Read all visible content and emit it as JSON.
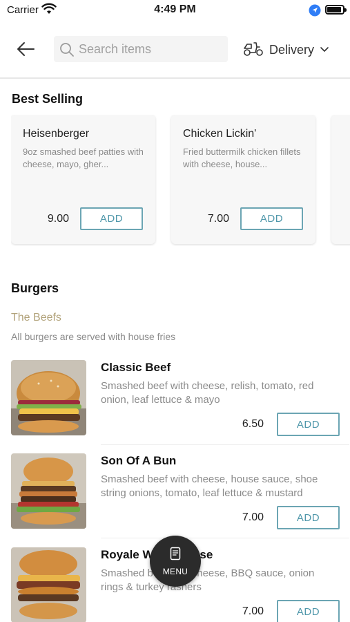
{
  "status_bar": {
    "carrier": "Carrier",
    "time": "4:49 PM"
  },
  "header": {
    "search_placeholder": "Search items",
    "delivery_label": "Delivery"
  },
  "best_selling": {
    "title": "Best Selling",
    "items": [
      {
        "name": "Heisenberger",
        "description": "9oz smashed beef patties with cheese, mayo, gher...",
        "price": "9.00",
        "add_label": "ADD"
      },
      {
        "name": "Chicken Lickin'",
        "description": "Fried buttermilk chicken fillets with cheese, house...",
        "price": "7.00",
        "add_label": "ADD"
      }
    ]
  },
  "burgers": {
    "title": "Burgers",
    "category": "The Beefs",
    "note": "All burgers are served with house fries",
    "items": [
      {
        "name": "Classic Beef",
        "description": "Smashed beef with cheese, relish, tomato, red onion, leaf lettuce & mayo",
        "price": "6.50",
        "add_label": "ADD"
      },
      {
        "name": "Son Of A Bun",
        "description": "Smashed beef with cheese, house sauce, shoe string onions, tomato, leaf lettuce & mustard",
        "price": "7.00",
        "add_label": "ADD"
      },
      {
        "name": "Royale With Cheese",
        "description": "Smashed beef with cheese, BBQ sauce, onion rings & turkey rashers",
        "price": "7.00",
        "add_label": "ADD"
      }
    ]
  },
  "fab": {
    "label": "MENU"
  },
  "colors": {
    "accent": "#4f97aa",
    "category": "#b2a37b",
    "fab": "#2b2b2b"
  }
}
